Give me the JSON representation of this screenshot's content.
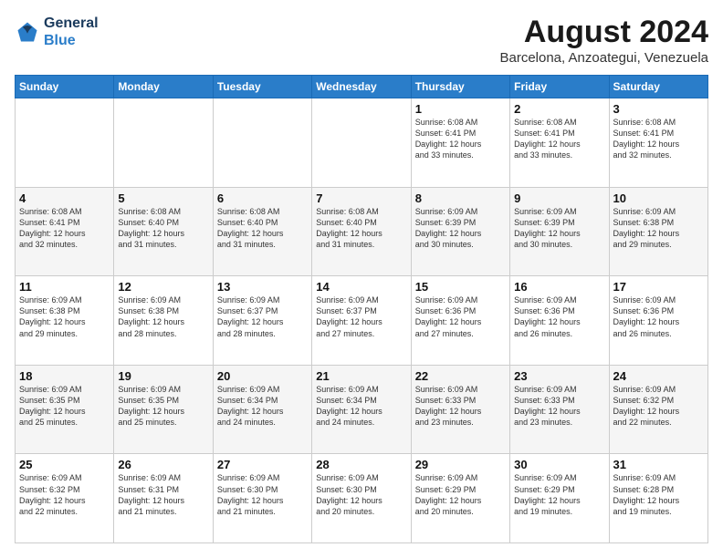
{
  "header": {
    "logo_line1": "General",
    "logo_line2": "Blue",
    "main_title": "August 2024",
    "subtitle": "Barcelona, Anzoategui, Venezuela"
  },
  "days_of_week": [
    "Sunday",
    "Monday",
    "Tuesday",
    "Wednesday",
    "Thursday",
    "Friday",
    "Saturday"
  ],
  "weeks": [
    [
      {
        "day": "",
        "info": ""
      },
      {
        "day": "",
        "info": ""
      },
      {
        "day": "",
        "info": ""
      },
      {
        "day": "",
        "info": ""
      },
      {
        "day": "1",
        "info": "Sunrise: 6:08 AM\nSunset: 6:41 PM\nDaylight: 12 hours\nand 33 minutes."
      },
      {
        "day": "2",
        "info": "Sunrise: 6:08 AM\nSunset: 6:41 PM\nDaylight: 12 hours\nand 33 minutes."
      },
      {
        "day": "3",
        "info": "Sunrise: 6:08 AM\nSunset: 6:41 PM\nDaylight: 12 hours\nand 32 minutes."
      }
    ],
    [
      {
        "day": "4",
        "info": "Sunrise: 6:08 AM\nSunset: 6:41 PM\nDaylight: 12 hours\nand 32 minutes."
      },
      {
        "day": "5",
        "info": "Sunrise: 6:08 AM\nSunset: 6:40 PM\nDaylight: 12 hours\nand 31 minutes."
      },
      {
        "day": "6",
        "info": "Sunrise: 6:08 AM\nSunset: 6:40 PM\nDaylight: 12 hours\nand 31 minutes."
      },
      {
        "day": "7",
        "info": "Sunrise: 6:08 AM\nSunset: 6:40 PM\nDaylight: 12 hours\nand 31 minutes."
      },
      {
        "day": "8",
        "info": "Sunrise: 6:09 AM\nSunset: 6:39 PM\nDaylight: 12 hours\nand 30 minutes."
      },
      {
        "day": "9",
        "info": "Sunrise: 6:09 AM\nSunset: 6:39 PM\nDaylight: 12 hours\nand 30 minutes."
      },
      {
        "day": "10",
        "info": "Sunrise: 6:09 AM\nSunset: 6:38 PM\nDaylight: 12 hours\nand 29 minutes."
      }
    ],
    [
      {
        "day": "11",
        "info": "Sunrise: 6:09 AM\nSunset: 6:38 PM\nDaylight: 12 hours\nand 29 minutes."
      },
      {
        "day": "12",
        "info": "Sunrise: 6:09 AM\nSunset: 6:38 PM\nDaylight: 12 hours\nand 28 minutes."
      },
      {
        "day": "13",
        "info": "Sunrise: 6:09 AM\nSunset: 6:37 PM\nDaylight: 12 hours\nand 28 minutes."
      },
      {
        "day": "14",
        "info": "Sunrise: 6:09 AM\nSunset: 6:37 PM\nDaylight: 12 hours\nand 27 minutes."
      },
      {
        "day": "15",
        "info": "Sunrise: 6:09 AM\nSunset: 6:36 PM\nDaylight: 12 hours\nand 27 minutes."
      },
      {
        "day": "16",
        "info": "Sunrise: 6:09 AM\nSunset: 6:36 PM\nDaylight: 12 hours\nand 26 minutes."
      },
      {
        "day": "17",
        "info": "Sunrise: 6:09 AM\nSunset: 6:36 PM\nDaylight: 12 hours\nand 26 minutes."
      }
    ],
    [
      {
        "day": "18",
        "info": "Sunrise: 6:09 AM\nSunset: 6:35 PM\nDaylight: 12 hours\nand 25 minutes."
      },
      {
        "day": "19",
        "info": "Sunrise: 6:09 AM\nSunset: 6:35 PM\nDaylight: 12 hours\nand 25 minutes."
      },
      {
        "day": "20",
        "info": "Sunrise: 6:09 AM\nSunset: 6:34 PM\nDaylight: 12 hours\nand 24 minutes."
      },
      {
        "day": "21",
        "info": "Sunrise: 6:09 AM\nSunset: 6:34 PM\nDaylight: 12 hours\nand 24 minutes."
      },
      {
        "day": "22",
        "info": "Sunrise: 6:09 AM\nSunset: 6:33 PM\nDaylight: 12 hours\nand 23 minutes."
      },
      {
        "day": "23",
        "info": "Sunrise: 6:09 AM\nSunset: 6:33 PM\nDaylight: 12 hours\nand 23 minutes."
      },
      {
        "day": "24",
        "info": "Sunrise: 6:09 AM\nSunset: 6:32 PM\nDaylight: 12 hours\nand 22 minutes."
      }
    ],
    [
      {
        "day": "25",
        "info": "Sunrise: 6:09 AM\nSunset: 6:32 PM\nDaylight: 12 hours\nand 22 minutes."
      },
      {
        "day": "26",
        "info": "Sunrise: 6:09 AM\nSunset: 6:31 PM\nDaylight: 12 hours\nand 21 minutes."
      },
      {
        "day": "27",
        "info": "Sunrise: 6:09 AM\nSunset: 6:30 PM\nDaylight: 12 hours\nand 21 minutes."
      },
      {
        "day": "28",
        "info": "Sunrise: 6:09 AM\nSunset: 6:30 PM\nDaylight: 12 hours\nand 20 minutes."
      },
      {
        "day": "29",
        "info": "Sunrise: 6:09 AM\nSunset: 6:29 PM\nDaylight: 12 hours\nand 20 minutes."
      },
      {
        "day": "30",
        "info": "Sunrise: 6:09 AM\nSunset: 6:29 PM\nDaylight: 12 hours\nand 19 minutes."
      },
      {
        "day": "31",
        "info": "Sunrise: 6:09 AM\nSunset: 6:28 PM\nDaylight: 12 hours\nand 19 minutes."
      }
    ]
  ]
}
